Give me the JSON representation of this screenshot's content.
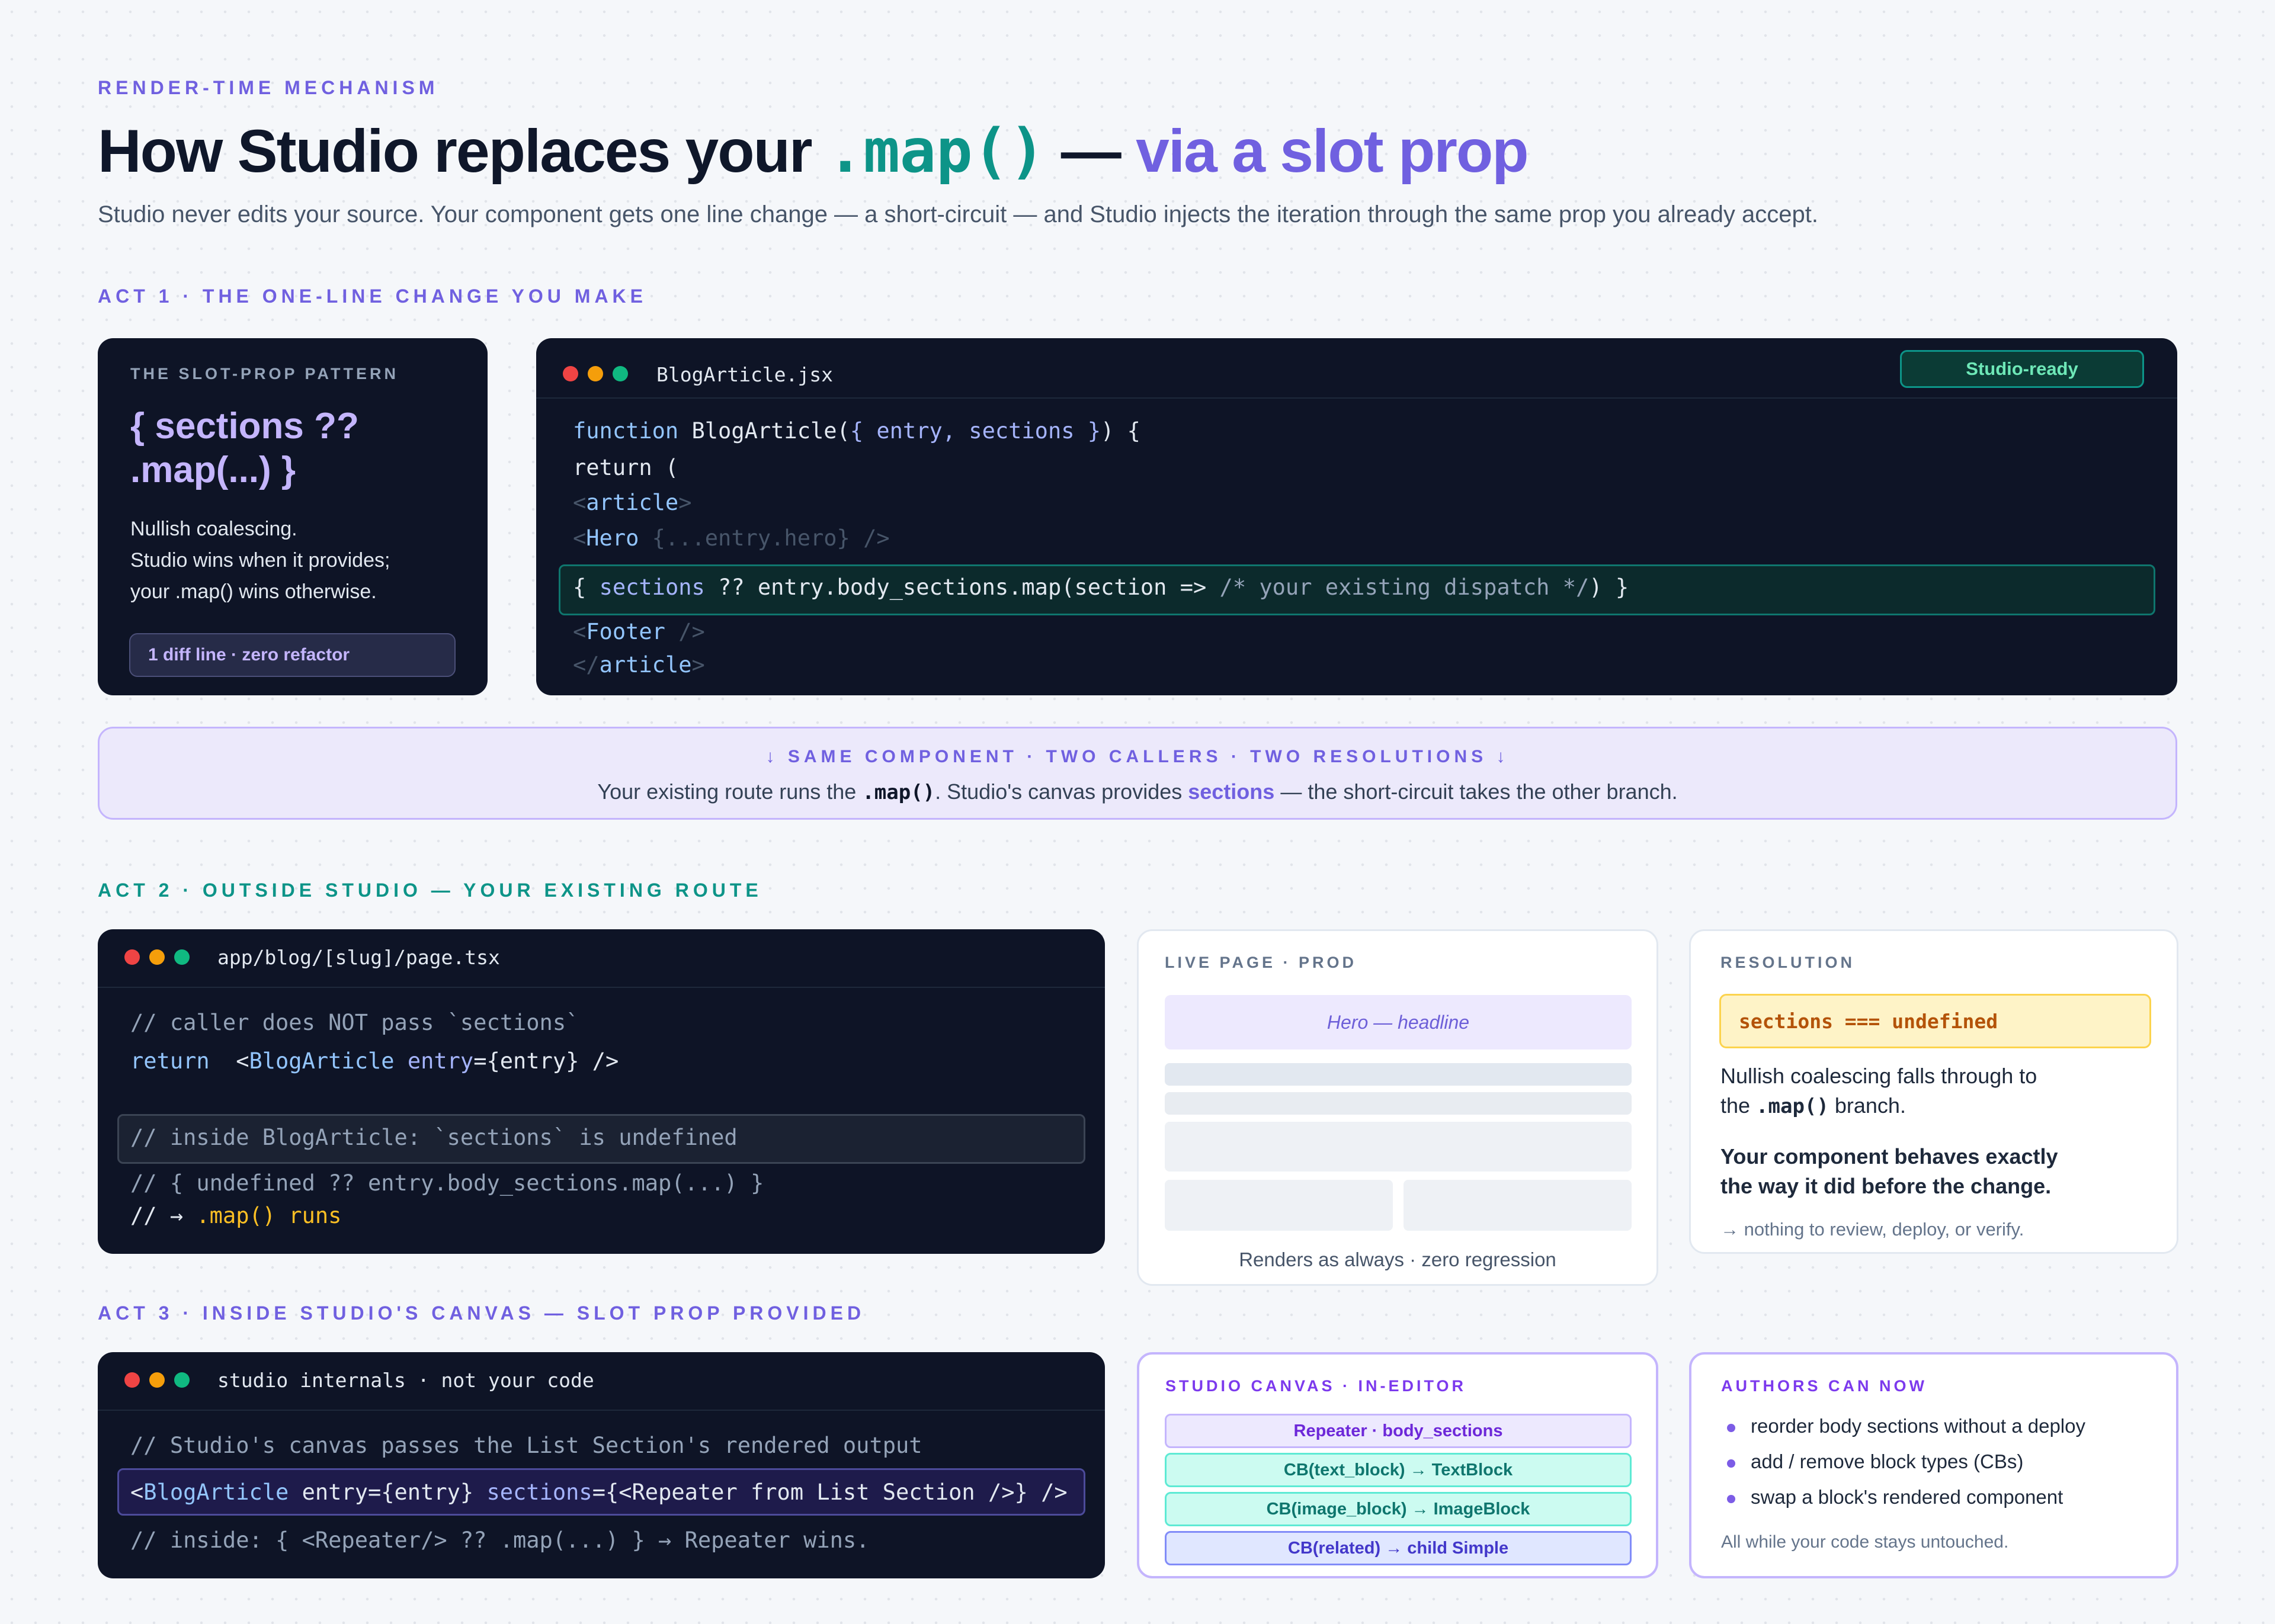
{
  "header": {
    "eyebrow": "RENDER-TIME MECHANISM",
    "title_part1": "How Studio replaces your ",
    "title_code": ".map()",
    "title_dash": " — ",
    "title_accent": "via a slot prop",
    "subtitle": "Studio never edits your source. Your component gets one line change — a short-circuit — and Studio injects the iteration through the same prop you already accept."
  },
  "act1": {
    "label": "ACT 1 · THE ONE-LINE CHANGE YOU MAKE",
    "pattern_card": {
      "eyebrow": "THE SLOT-PROP PATTERN",
      "heading_line1": "{ sections ??",
      "heading_line2": ".map(...) }",
      "desc_line1": "Nullish coalescing.",
      "desc_line2": "Studio wins when it provides;",
      "desc_line3": "your .map() wins otherwise.",
      "badge": "1 diff line · zero refactor"
    },
    "editor": {
      "filename": "BlogArticle.jsx",
      "status_badge": "Studio-ready",
      "l1_kw": "function",
      "l1_fn": " BlogArticle(",
      "l1_prm": "{ entry, sections }",
      "l1_end": ") {",
      "l2": "return (",
      "l3_open": "<",
      "l3_tag": "article",
      "l3_close": ">",
      "l4_open": "<",
      "l4_tag": "Hero",
      "l4_rest": " {...entry.hero} />",
      "l5_a": "{ ",
      "l5_b": "sections",
      "l5_c": " ?? entry.body_sections.map(section => ",
      "l5_d": "/* your existing dispatch */",
      "l5_e": ") }",
      "l6_open": "<",
      "l6_tag": "Footer",
      "l6_close": " />",
      "l7_open": "</",
      "l7_tag": "article",
      "l7_close": ">"
    }
  },
  "banner": {
    "title": "↓ SAME COMPONENT · TWO CALLERS · TWO RESOLUTIONS ↓",
    "text_a": "Your existing route runs the ",
    "text_b": ".map()",
    "text_c": ". Studio's canvas provides ",
    "text_d": "sections",
    "text_e": " — the short-circuit takes the other branch."
  },
  "act2": {
    "label": "ACT 2 · OUTSIDE STUDIO — YOUR EXISTING ROUTE",
    "editor": {
      "filename": "app/blog/[slug]/page.tsx",
      "l1": "// caller does NOT pass `sections`",
      "l2_kw": "return",
      "l2_a": "  <",
      "l2_tag": "BlogArticle",
      "l2_b": " ",
      "l2_attr": "entry",
      "l2_c": "={entry} />",
      "l3": "// inside BlogArticle: `sections` is undefined",
      "l4": "// { undefined ?? entry.body_sections.map(...) }",
      "l5_a": "// → ",
      "l5_b": ".map() runs"
    },
    "live": {
      "eyebrow": "LIVE PAGE · PROD",
      "hero": "Hero — headline",
      "caption": "Renders as always · zero regression"
    },
    "resolution": {
      "eyebrow": "RESOLUTION",
      "code": "sections === undefined",
      "p1_line1": "Nullish coalescing falls through to",
      "p1_line2a": "the ",
      "p1_line2b": ".map()",
      "p1_line2c": " branch.",
      "p2_line1": "Your component behaves exactly",
      "p2_line2": "the way it did before the change.",
      "foot": "→ nothing to review, deploy, or verify."
    }
  },
  "act3": {
    "label": "ACT 3 · INSIDE STUDIO'S CANVAS — SLOT PROP PROVIDED",
    "editor": {
      "filename": "studio internals · not your code",
      "l1": "// Studio's canvas passes the List Section's rendered output",
      "l2_a": "<",
      "l2_tag": "BlogArticle",
      "l2_b": " entry={entry} ",
      "l2_attr": "sections",
      "l2_c": "={<Repeater from List Section />} />",
      "l3": "// inside: { <Repeater/> ?? .map(...) } → Repeater wins."
    },
    "canvas": {
      "eyebrow": "STUDIO CANVAS · IN-EDITOR",
      "items": [
        "Repeater · body_sections",
        "CB(text_block) → TextBlock",
        "CB(image_block) → ImageBlock",
        "CB(related) → child Simple"
      ]
    },
    "authors": {
      "eyebrow": "AUTHORS CAN NOW",
      "bullets": [
        "reorder body sections without a deploy",
        "add / remove block types (CBs)",
        "swap a block's rendered component"
      ],
      "foot": "All while your code stays untouched."
    }
  },
  "colors": {
    "accent": "#7060e0",
    "teal": "#0d9488",
    "dark": "#0e1426",
    "amber": "#fbbf24"
  }
}
